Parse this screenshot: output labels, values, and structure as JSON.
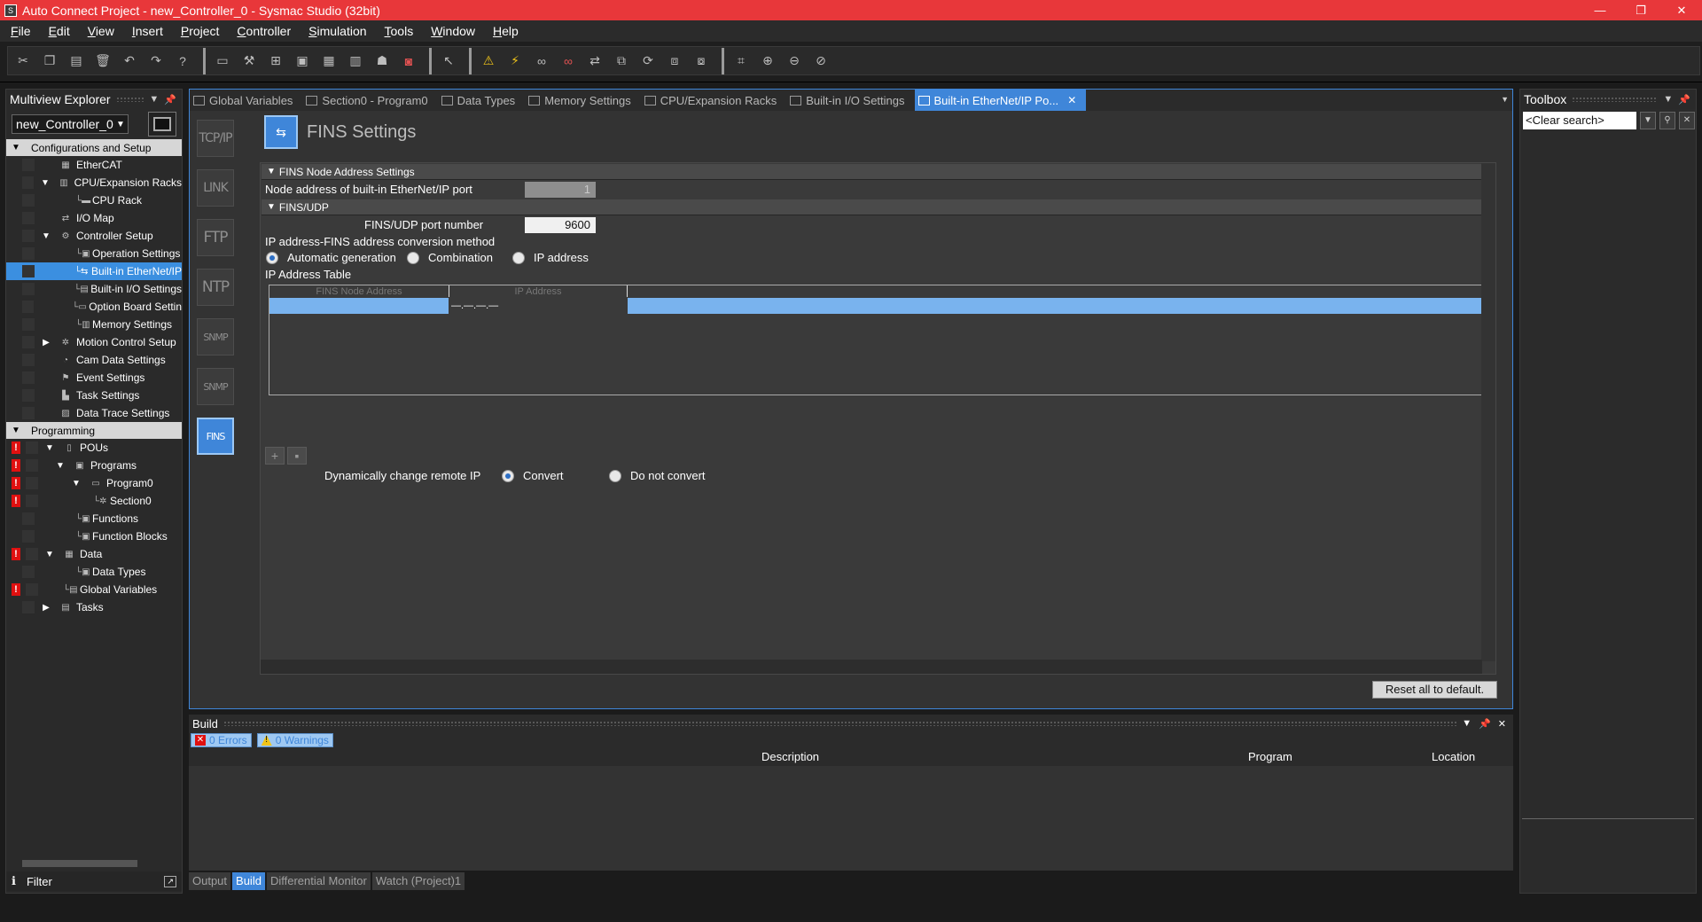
{
  "window": {
    "title": "Auto Connect Project - new_Controller_0 - Sysmac Studio (32bit)",
    "min": "—",
    "max": "❐",
    "close": "✕"
  },
  "menu": [
    "File",
    "Edit",
    "View",
    "Insert",
    "Project",
    "Controller",
    "Simulation",
    "Tools",
    "Window",
    "Help"
  ],
  "explorer": {
    "title": "Multiview Explorer",
    "controller": "new_Controller_0",
    "filter_label": "Filter",
    "items": [
      {
        "label": "Configurations and Setup",
        "type": "section"
      },
      {
        "label": "EtherCAT"
      },
      {
        "label": "CPU/Expansion Racks"
      },
      {
        "label": "CPU Rack"
      },
      {
        "label": "I/O Map"
      },
      {
        "label": "Controller Setup"
      },
      {
        "label": "Operation Settings"
      },
      {
        "label": "Built-in EtherNet/IP"
      },
      {
        "label": "Built-in I/O Settings"
      },
      {
        "label": "Option Board Settin"
      },
      {
        "label": "Memory Settings"
      },
      {
        "label": "Motion Control Setup"
      },
      {
        "label": "Cam Data Settings"
      },
      {
        "label": "Event Settings"
      },
      {
        "label": "Task Settings"
      },
      {
        "label": "Data Trace Settings"
      },
      {
        "label": "Programming",
        "type": "section"
      },
      {
        "label": "POUs"
      },
      {
        "label": "Programs"
      },
      {
        "label": "Program0"
      },
      {
        "label": "Section0"
      },
      {
        "label": "Functions"
      },
      {
        "label": "Function Blocks"
      },
      {
        "label": "Data"
      },
      {
        "label": "Data Types"
      },
      {
        "label": "Global Variables"
      },
      {
        "label": "Tasks"
      }
    ]
  },
  "tabs": [
    {
      "label": "Global Variables"
    },
    {
      "label": "Section0 - Program0"
    },
    {
      "label": "Data Types"
    },
    {
      "label": "Memory Settings"
    },
    {
      "label": "CPU/Expansion Racks"
    },
    {
      "label": "Built-in I/O Settings"
    },
    {
      "label": "Built-in EtherNet/IP Po...",
      "active": true
    }
  ],
  "nav": [
    "TCP/IP",
    "LINK",
    "FTP",
    "NTP",
    "SNMP",
    "SNMP",
    "FINS"
  ],
  "page": {
    "title": "FINS Settings",
    "section1": "FINS Node Address Settings",
    "node_label": "Node address of built-in EtherNet/IP port",
    "node_value": "1",
    "section2": "FINS/UDP",
    "port_label": "FINS/UDP port number",
    "port_value": "9600",
    "conv_label": "IP address-FINS address conversion method",
    "radio_auto": "Automatic generation",
    "radio_comb": "Combination",
    "radio_ip": "IP address",
    "table_label": "IP Address Table",
    "col_node": "FINS Node Address",
    "col_ip": "IP Address",
    "row_ip": "—.—.—.—",
    "dyn_label": "Dynamically change remote IP",
    "dyn_convert": "Convert",
    "dyn_noconvert": "Do not convert",
    "reset": "Reset all to default."
  },
  "toolbox": {
    "title": "Toolbox",
    "search": "<Clear search>"
  },
  "build": {
    "title": "Build",
    "errors": "0  Errors",
    "warnings": "0  Warnings",
    "col_desc": "Description",
    "col_program": "Program",
    "col_location": "Location"
  },
  "bottom_tabs": [
    "Output",
    "Build",
    "Differential Monitor",
    "Watch (Project)1"
  ]
}
